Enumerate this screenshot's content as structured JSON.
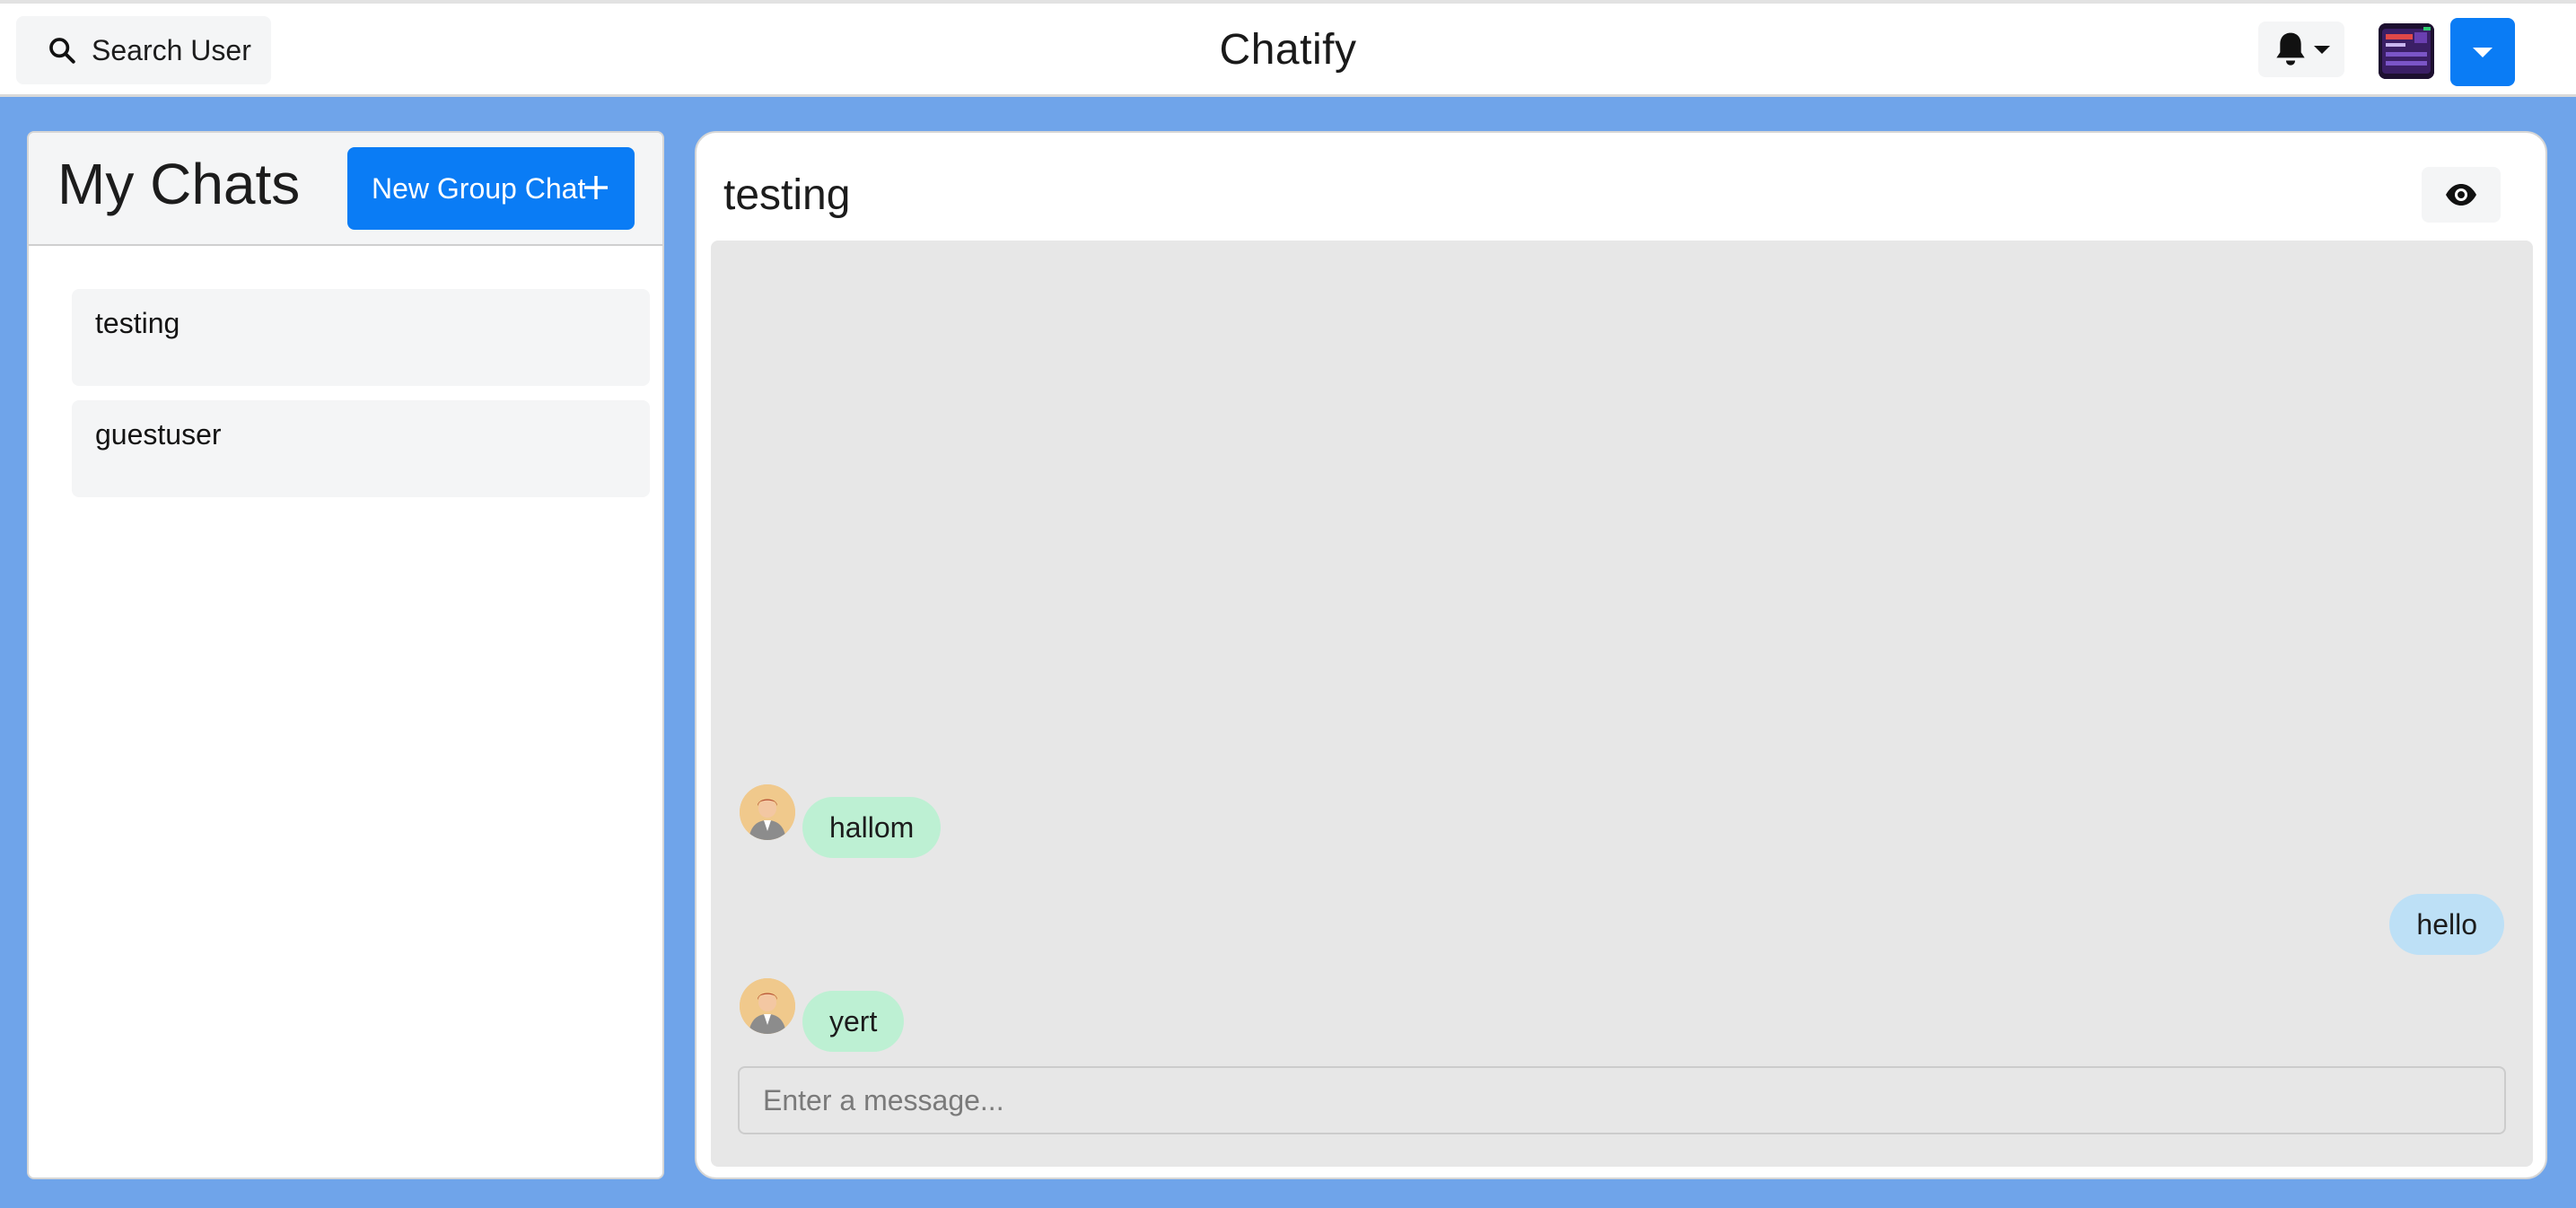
{
  "header": {
    "search_label": "Search User",
    "app_title": "Chatify",
    "icons": {
      "search": "search-icon",
      "bell": "bell-icon",
      "menu_caret": "chevron-down-icon"
    }
  },
  "sidebar": {
    "title": "My Chats",
    "new_group_label": "New Group Chat",
    "chats": [
      {
        "name": "testing"
      },
      {
        "name": "guestuser"
      }
    ]
  },
  "conversation": {
    "title": "testing",
    "messages": [
      {
        "text": "hallom",
        "direction": "incoming",
        "show_avatar": true
      },
      {
        "text": "hello",
        "direction": "outgoing",
        "show_avatar": false
      },
      {
        "text": "yert",
        "direction": "incoming",
        "show_avatar": true
      }
    ],
    "input_placeholder": "Enter a message..."
  },
  "colors": {
    "page_background": "#6fa4ea",
    "primary": "#0a7cf5",
    "incoming_bubble": "#bdf0d3",
    "outgoing_bubble": "#bde0f6",
    "messages_background": "#e7e7e7"
  }
}
